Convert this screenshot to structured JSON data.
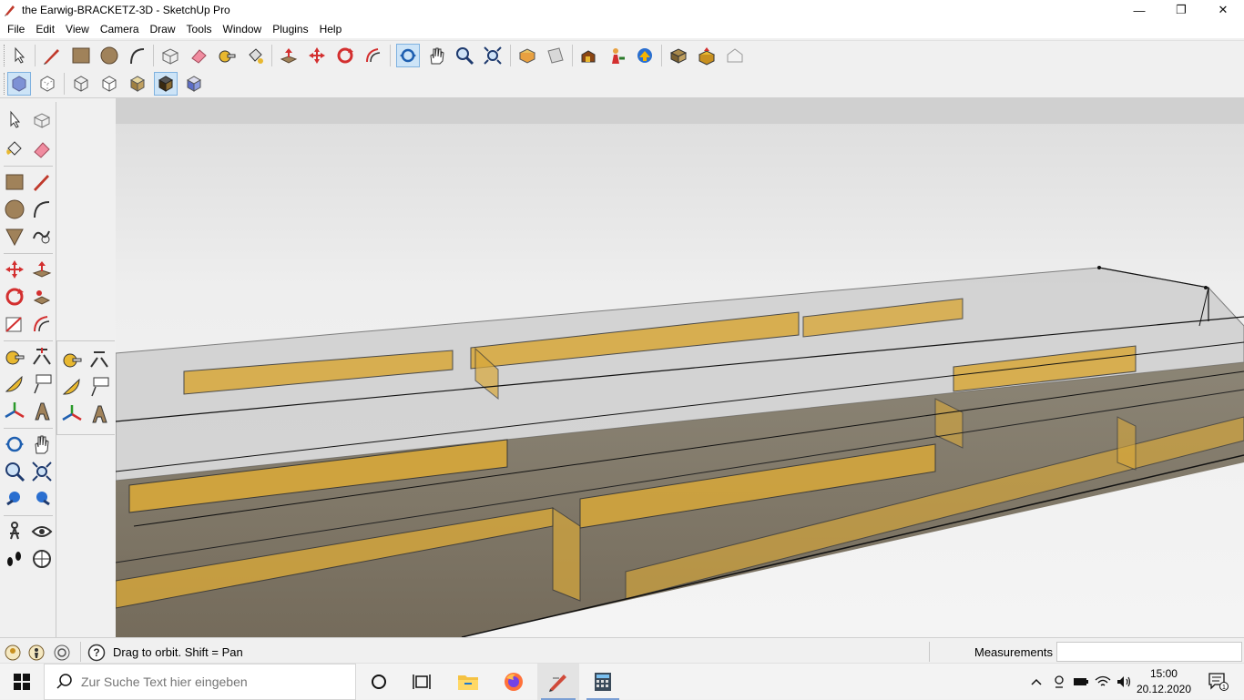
{
  "window": {
    "title": "the Earwig-BRACKETZ-3D - SketchUp Pro",
    "minimize": "—",
    "maximize": "❐",
    "close": "✕"
  },
  "menu": [
    "File",
    "Edit",
    "View",
    "Camera",
    "Draw",
    "Tools",
    "Window",
    "Plugins",
    "Help"
  ],
  "toolbar_main": [
    {
      "name": "select-icon"
    },
    {
      "name": "pencil-line-icon"
    },
    {
      "name": "rectangle-icon"
    },
    {
      "name": "circle-icon"
    },
    {
      "name": "arc-icon"
    },
    {
      "name": "make-component-icon"
    },
    {
      "name": "eraser-icon"
    },
    {
      "name": "tape-measure-icon"
    },
    {
      "name": "paint-bucket-icon"
    },
    {
      "name": "push-pull-icon"
    },
    {
      "name": "move-icon"
    },
    {
      "name": "rotate-icon"
    },
    {
      "name": "offset-icon"
    },
    {
      "name": "orbit-icon"
    },
    {
      "name": "pan-icon"
    },
    {
      "name": "zoom-icon"
    },
    {
      "name": "zoom-extents-icon"
    },
    {
      "name": "add-location-icon"
    },
    {
      "name": "toggle-terrain-icon"
    },
    {
      "name": "get-models-icon"
    },
    {
      "name": "share-model-icon"
    },
    {
      "name": "preview-in-earth-icon"
    },
    {
      "name": "get-components-icon"
    },
    {
      "name": "share-component-icon"
    },
    {
      "name": "extension-warehouse-icon"
    }
  ],
  "toolbar_styles": [
    {
      "name": "xray-icon"
    },
    {
      "name": "back-edges-icon"
    },
    {
      "name": "wireframe-icon"
    },
    {
      "name": "hidden-line-icon"
    },
    {
      "name": "shaded-icon"
    },
    {
      "name": "shaded-with-textures-icon"
    },
    {
      "name": "monochrome-icon"
    }
  ],
  "status": {
    "hint": "Drag to orbit.  Shift = Pan",
    "measurements_label": "Measurements",
    "measurements_value": ""
  },
  "taskbar": {
    "search_placeholder": "Zur Suche Text hier eingeben",
    "time": "15:00",
    "date": "20.12.2020",
    "notification_count": "1"
  },
  "colors": {
    "accent": "#0078d7",
    "wood": "#d8a83a",
    "sky": "#e9e9e9"
  }
}
